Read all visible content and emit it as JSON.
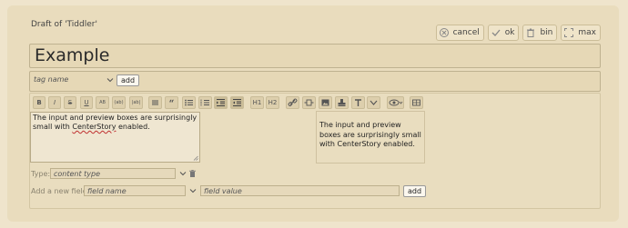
{
  "header": {
    "draft_title": "Draft of 'Tiddler'",
    "buttons": [
      {
        "label": "cancel",
        "icon": "cancel-icon"
      },
      {
        "label": "ok",
        "icon": "check-icon"
      },
      {
        "label": "bin",
        "icon": "trash-icon"
      },
      {
        "label": "max",
        "icon": "maximize-icon"
      }
    ]
  },
  "title": {
    "value": "Example"
  },
  "tags": {
    "placeholder": "tag name",
    "add_label": "add"
  },
  "toolbar": {
    "items": [
      {
        "label": "B",
        "icon": "bold-icon"
      },
      {
        "label": "I",
        "icon": "italic-icon"
      },
      {
        "label": "S",
        "icon": "strikethrough-icon"
      },
      {
        "label": "U",
        "icon": "underline-icon"
      },
      {
        "label": "AB",
        "icon": "superscript-icon"
      },
      {
        "label": "(ab)",
        "icon": "subscript-icon"
      },
      {
        "label": "|ab|",
        "icon": "mono-line-icon"
      },
      {
        "label": "",
        "icon": "mono-block-icon"
      },
      {
        "label": "",
        "icon": "quote-icon"
      },
      {
        "label": "",
        "icon": "bullet-list-icon"
      },
      {
        "label": "",
        "icon": "numbered-list-icon"
      },
      {
        "label": "",
        "icon": "indent-icon"
      },
      {
        "label": "",
        "icon": "outdent-icon"
      },
      {
        "label": "H1",
        "icon": "heading-1-icon"
      },
      {
        "label": "H2",
        "icon": "heading-2-icon"
      },
      {
        "label": "",
        "icon": "link-icon"
      },
      {
        "label": "",
        "icon": "transclude-icon"
      },
      {
        "label": "",
        "icon": "picture-icon"
      },
      {
        "label": "",
        "icon": "stamp-icon"
      },
      {
        "label": "",
        "icon": "text-size-icon"
      },
      {
        "label": "",
        "icon": "more-icon"
      },
      {
        "label": "",
        "icon": "preview-icon"
      },
      {
        "label": "",
        "icon": "preview-type-icon"
      }
    ]
  },
  "editor": {
    "text_before": "The input and preview boxes are surprisingly small with ",
    "misspelled": "CenterStory",
    "text_after": " enabled."
  },
  "preview": {
    "text": "The input and preview boxes are surprisingly small with CenterStory enabled."
  },
  "type_field": {
    "label": "Type:",
    "placeholder": "content type"
  },
  "new_field": {
    "label": "Add a new field:",
    "name_placeholder": "field name",
    "value_placeholder": "field value",
    "add_label": "add"
  }
}
